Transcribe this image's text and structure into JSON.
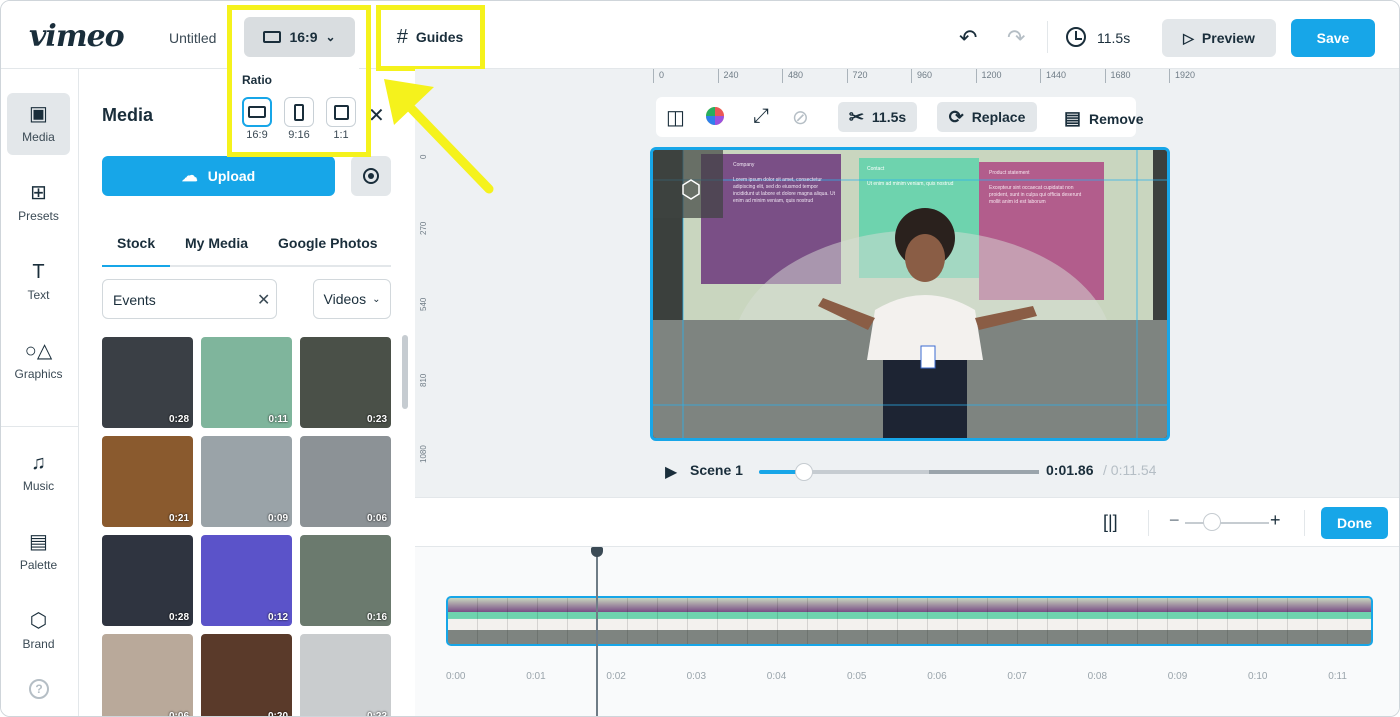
{
  "app": {
    "logo": "vimeo",
    "project_title": "Untitled"
  },
  "header": {
    "ratio_label": "16:9",
    "guides_label": "Guides",
    "duration": "11.5s",
    "preview_label": "Preview",
    "save_label": "Save"
  },
  "ratio_popover": {
    "label": "Ratio",
    "options": [
      "16:9",
      "9:16",
      "1:1"
    ],
    "selected": "16:9"
  },
  "rail": {
    "items": [
      {
        "label": "Media",
        "icon": "image-icon"
      },
      {
        "label": "Presets",
        "icon": "grid-icon"
      },
      {
        "label": "Text",
        "icon": "text-icon"
      },
      {
        "label": "Graphics",
        "icon": "shapes-icon"
      },
      {
        "label": "Music",
        "icon": "music-note-icon"
      },
      {
        "label": "Palette",
        "icon": "palette-icon"
      },
      {
        "label": "Brand",
        "icon": "brand-icon"
      }
    ]
  },
  "panel": {
    "title": "Media",
    "upload_label": "Upload",
    "tabs": [
      "Stock",
      "My Media",
      "Google Photos"
    ],
    "active_tab": "Stock",
    "search_value": "Events",
    "type_select": "Videos",
    "thumbnails": [
      {
        "duration": "0:28",
        "color": "#3a3f45"
      },
      {
        "duration": "0:11",
        "color": "#7fb59c"
      },
      {
        "duration": "0:23",
        "color": "#4a5048"
      },
      {
        "duration": "0:21",
        "color": "#8a5a2e"
      },
      {
        "duration": "0:09",
        "color": "#9aa3a8"
      },
      {
        "duration": "0:06",
        "color": "#8c9296"
      },
      {
        "duration": "0:28",
        "color": "#2f3440"
      },
      {
        "duration": "0:12",
        "color": "#5b53c9"
      },
      {
        "duration": "0:16",
        "color": "#6b7a6e"
      },
      {
        "duration": "0:06",
        "color": "#b9a99a"
      },
      {
        "duration": "0:20",
        "color": "#5a3a2a"
      },
      {
        "duration": "0:23",
        "color": "#c9ccce"
      }
    ]
  },
  "canvas": {
    "ruler_top": [
      "0",
      "240",
      "480",
      "720",
      "960",
      "1200",
      "1440",
      "1680",
      "1920"
    ],
    "ruler_left": [
      "0",
      "270",
      "540",
      "810",
      "1080"
    ],
    "toolbar": {
      "trim_duration": "11.5s",
      "replace_label": "Replace",
      "remove_label": "Remove"
    },
    "slides": [
      {
        "heading": "Company",
        "body": "Lorem ipsum dolor sit amet, consectetur adipiscing elit, sed do eiusmod tempor incididunt ut labore et dolore magna aliqua. Ut enim ad minim veniam, quis nostrud"
      },
      {
        "heading": "Contact",
        "body": "Ut enim ad minim veniam, quis nostrud"
      },
      {
        "heading": "Product statement",
        "body": "Excepteur sint occaecat cupidatat non proident, sunt in culpa qui officia deserunt mollit anim id est laborum"
      }
    ],
    "scene_label": "Scene 1",
    "progress": 0.161,
    "time_current": "0:01.86",
    "time_total": "/ 0:11.54"
  },
  "timeline": {
    "done_label": "Done",
    "zoom_level": 0.05,
    "ticks": [
      "0:00",
      "0:01",
      "0:02",
      "0:03",
      "0:04",
      "0:05",
      "0:06",
      "0:07",
      "0:08",
      "0:09",
      "0:10",
      "0:11"
    ]
  },
  "colors": {
    "accent": "#17a6e8",
    "highlight": "#f5f21c",
    "text": "#1a2e3b"
  }
}
